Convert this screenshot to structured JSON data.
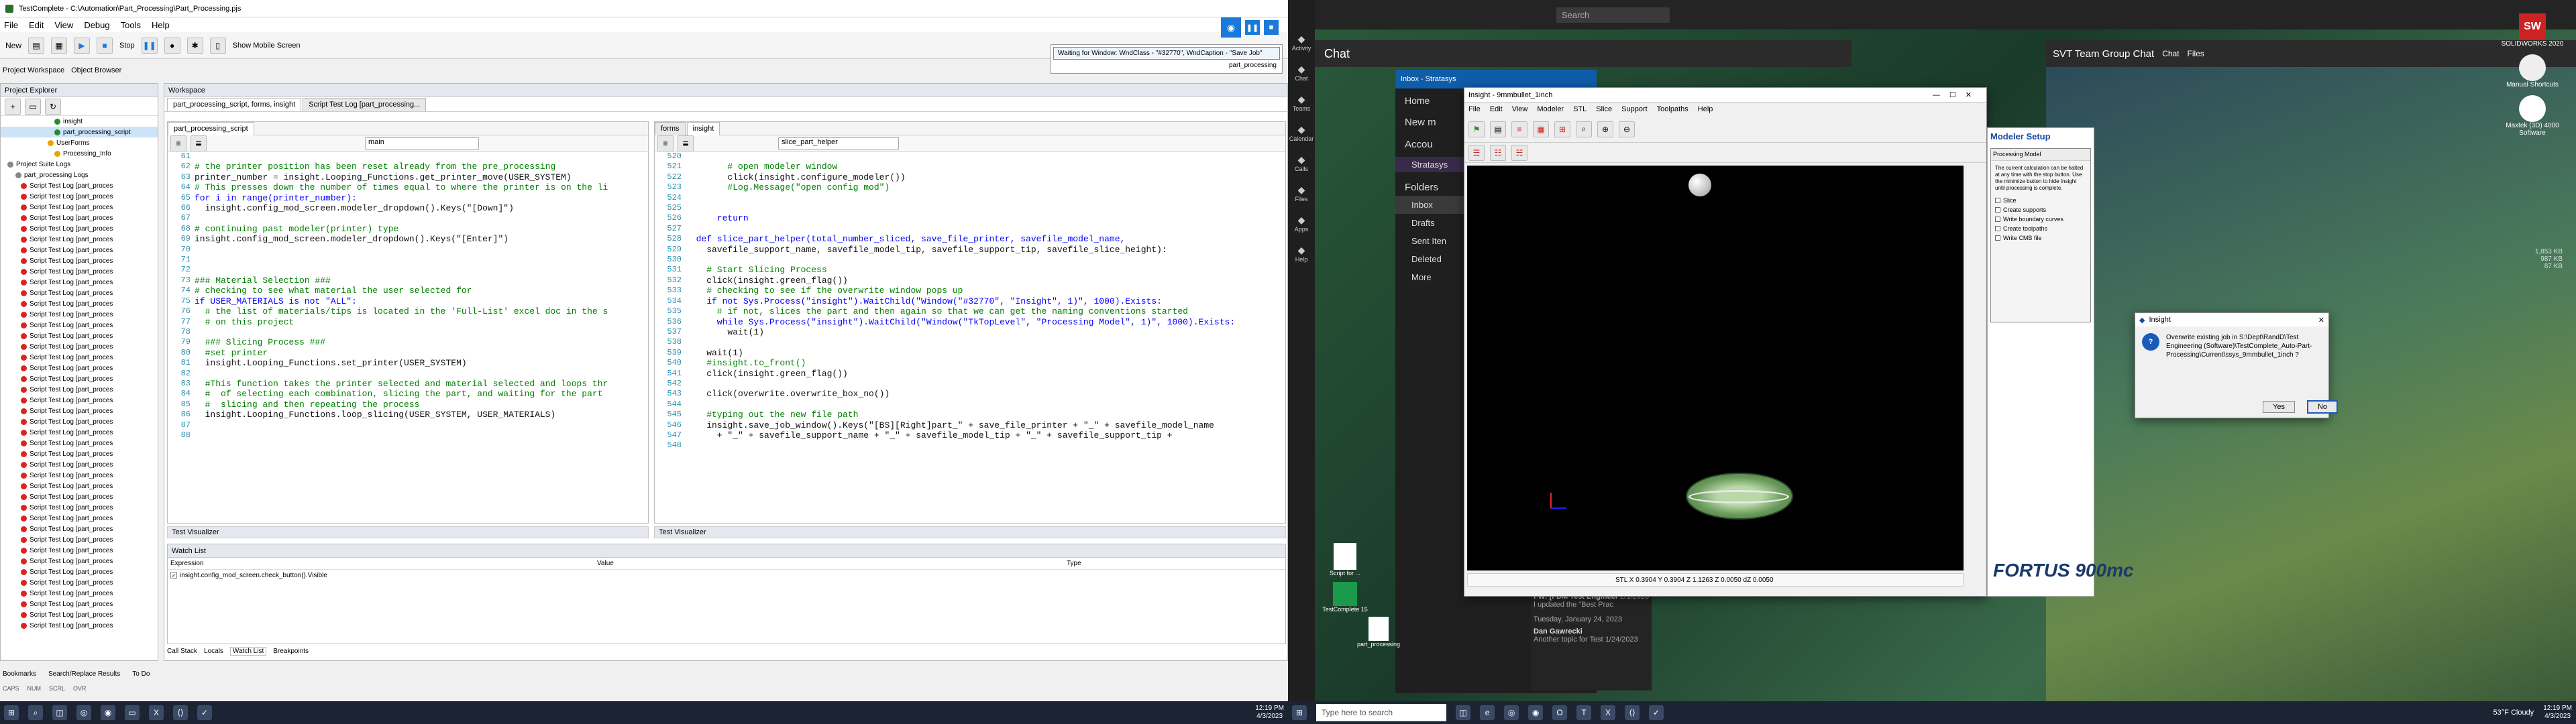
{
  "left": {
    "title": "TestComplete - C:\\Automation\\Part_Processing\\Part_Processing.pjs",
    "menu": [
      "File",
      "Edit",
      "View",
      "Debug",
      "Tools",
      "Help"
    ],
    "toolbar": {
      "new_label": "New",
      "stop_label": "Stop",
      "mobile_label": "Show Mobile Screen"
    },
    "waiting_text": "Waiting for Window: WndClass - \"#32770\", WndCaption - \"Save Job\"",
    "waiting_sub": "part_processing",
    "project_tabs": [
      "Project Workspace",
      "Object Browser"
    ],
    "explorer_title": "Project Explorer",
    "tree_top": [
      "insight",
      "part_processing_script",
      "UserForms",
      "Processing_Info"
    ],
    "suite_logs": "Project Suite Logs",
    "processing_logs": "part_processing Logs",
    "log_item": "Script Test Log [part_proces",
    "workspace_title": "Workspace",
    "ws_tabs": [
      "part_processing_script, forms, insight",
      "Script Test Log [part_processing..."
    ],
    "left_editor_tab": "part_processing_script",
    "left_dropdown": "main",
    "right_editor_tabs": [
      "forms",
      "insight"
    ],
    "right_dropdown": "slice_part_helper",
    "left_code_start": 61,
    "left_code": [
      {
        "t": "",
        "c": ""
      },
      {
        "t": "# the printer position has been reset already from the pre_processing",
        "c": "cm"
      },
      {
        "t": "printer_number = insight.Looping_Functions.get_printer_move(USER_SYSTEM)",
        "c": ""
      },
      {
        "t": "# This presses down the number of times equal to where the printer is on the li",
        "c": "cm"
      },
      {
        "t": "for i in range(printer_number):",
        "c": "kw"
      },
      {
        "t": "  insight.config_mod_screen.modeler_dropdown().Keys(\"[Down]\")",
        "c": ""
      },
      {
        "t": "",
        "c": ""
      },
      {
        "t": "# continuing past modeler(printer) type",
        "c": "cm"
      },
      {
        "t": "insight.config_mod_screen.modeler_dropdown().Keys(\"[Enter]\")",
        "c": ""
      },
      {
        "t": "",
        "c": ""
      },
      {
        "t": "",
        "c": ""
      },
      {
        "t": "",
        "c": ""
      },
      {
        "t": "### Material Selection ###",
        "c": "cm"
      },
      {
        "t": "# checking to see what material the user selected for",
        "c": "cm"
      },
      {
        "t": "if USER_MATERIALS is not \"ALL\":",
        "c": "kw"
      },
      {
        "t": "  # the list of materials/tips is located in the 'Full-List' excel doc in the s",
        "c": "cm"
      },
      {
        "t": "  # on this project",
        "c": "cm"
      },
      {
        "t": "",
        "c": ""
      },
      {
        "t": "  ### Slicing Process ###",
        "c": "cm"
      },
      {
        "t": "  #set printer",
        "c": "cm"
      },
      {
        "t": "  insight.Looping_Functions.set_printer(USER_SYSTEM)",
        "c": ""
      },
      {
        "t": "",
        "c": ""
      },
      {
        "t": "  #This function takes the printer selected and material selected and loops thr",
        "c": "cm"
      },
      {
        "t": "  #  of selecting each combination, slicing the part, and waiting for the part",
        "c": "cm"
      },
      {
        "t": "  #  slicing and then repeating the process",
        "c": "cm"
      },
      {
        "t": "  insight.Looping_Functions.loop_slicing(USER_SYSTEM, USER_MATERIALS)",
        "c": ""
      },
      {
        "t": "",
        "c": ""
      },
      {
        "t": "",
        "c": ""
      }
    ],
    "right_code_start": 520,
    "right_code": [
      {
        "t": "",
        "c": ""
      },
      {
        "t": "        # open modeler window",
        "c": "cm"
      },
      {
        "t": "        click(insight.configure_modeler())",
        "c": ""
      },
      {
        "t": "        #Log.Message(\"open config mod\")",
        "c": "cm"
      },
      {
        "t": "",
        "c": ""
      },
      {
        "t": "",
        "c": ""
      },
      {
        "t": "      return",
        "c": "kw"
      },
      {
        "t": "",
        "c": ""
      },
      {
        "t": "  def slice_part_helper(total_number_sliced, save_file_printer, savefile_model_name,",
        "c": "kw"
      },
      {
        "t": "    savefile_support_name, savefile_model_tip, savefile_support_tip, savefile_slice_height):",
        "c": ""
      },
      {
        "t": "",
        "c": ""
      },
      {
        "t": "    # Start Slicing Process",
        "c": "cm"
      },
      {
        "t": "    click(insight.green_flag())",
        "c": ""
      },
      {
        "t": "    # checking to see if the overwrite window pops up",
        "c": "cm"
      },
      {
        "t": "    if not Sys.Process(\"insight\").WaitChild(\"Window(\"#32770\", \"Insight\", 1)\", 1000).Exists:",
        "c": "kw"
      },
      {
        "t": "      # if not, slices the part and then again so that we can get the naming conventions started",
        "c": "cm"
      },
      {
        "t": "      while Sys.Process(\"insight\").WaitChild(\"Window(\"TkTopLevel\", \"Processing Model\", 1)\", 1000).Exists:",
        "c": "kw"
      },
      {
        "t": "        wait(1)",
        "c": ""
      },
      {
        "t": "",
        "c": ""
      },
      {
        "t": "    wait(1)",
        "c": ""
      },
      {
        "t": "    #insight.to_front()",
        "c": "cm"
      },
      {
        "t": "    click(insight.green_flag())",
        "c": ""
      },
      {
        "t": "",
        "c": ""
      },
      {
        "t": "    click(overwrite.overwrite_box_no())",
        "c": ""
      },
      {
        "t": "",
        "c": ""
      },
      {
        "t": "    #typing out the new file path",
        "c": "cm"
      },
      {
        "t": "    insight.save_job_window().Keys(\"[BS][Right]part_\" + save_file_printer + \"_\" + savefile_model_name",
        "c": ""
      },
      {
        "t": "      + \"_\" + savefile_support_name + \"_\" + savefile_model_tip + \"_\" + savefile_support_tip +",
        "c": ""
      },
      {
        "t": "",
        "c": ""
      }
    ],
    "visualizer_label": "Test Visualizer",
    "watch_title": "Watch List",
    "watch_cols": [
      "Expression",
      "Value",
      "Type"
    ],
    "watch_row": "insight.config_mod_screen.check_button().Visible",
    "bottom_tabs": [
      "Call Stack",
      "Locals",
      "Watch List",
      "Breakpoints"
    ],
    "bottom_tabs2": [
      "Bookmarks",
      "Search/Replace Results",
      "To Do"
    ],
    "status": [
      "CAPS",
      "NUM",
      "SCRL",
      "OVR"
    ],
    "time": "12:19 PM",
    "date": "4/3/2023"
  },
  "right": {
    "chat_title": "Chat",
    "search_placeholder": "Search",
    "team_chat_title": "SVT Team Group Chat",
    "team_tabs": [
      "Chat",
      "Files"
    ],
    "sidebar": [
      "Activity",
      "Chat",
      "Teams",
      "Calendar",
      "Calls",
      "Files",
      "Apps",
      "Help"
    ],
    "outlook_title": "Inbox - Stratasys",
    "home": "Home",
    "new_mail": "New m",
    "account": "Accou",
    "stratasys": "Stratasys",
    "folders": "Folders",
    "folder_items": [
      "Inbox",
      "Drafts",
      "Sent Iten",
      "Deleted",
      "More"
    ],
    "insight_title": "Insight - 9mmbullet_1inch",
    "insight_menu": [
      "File",
      "Edit",
      "View",
      "Modeler",
      "STL",
      "Slice",
      "Support",
      "Toolpaths",
      "Help"
    ],
    "modeler_setup": "Modeler Setup",
    "proc_model_title": "Processing Model",
    "proc_desc": "The current calculation can be halted at any time with the stop button. Use the minimize button to hide Insight until processing is complete.",
    "checks": [
      "Slice",
      "Create supports",
      "Write boundary curves",
      "Create toolpaths",
      "Write CMB file"
    ],
    "dialog_title": "Insight",
    "dialog_msg": "Overwrite existing job in S:\\Dept\\RandD\\Test Engineering (Software)\\TestComplete_Auto-Part-Processing\\Current\\ssys_9mmbullet_1inch ?",
    "yes": "Yes",
    "no": "No",
    "fortus": "FORTUS 900mc",
    "status_bar": "STL  X 0.3904  Y 0.3904  Z 1.1263  Z 0.0050  dZ 0.0050",
    "mail_items": [
      {
        "title": "FW: [FDM Test Engineer",
        "date": "2/1/2023",
        "snippet": "I updated the \"Best Prac"
      },
      {
        "title": "Tuesday, January 24, 2023",
        "date": "",
        "snippet": ""
      },
      {
        "title": "Dan Gawrecki",
        "date": "",
        "snippet": "Another topic for Test"
      }
    ],
    "mail_date2": "1/24/2023",
    "desktop_icons": [
      "SOLIDWORKS 2020",
      "Manual Shortcuts",
      "Maxtek (3D) 4000 Software"
    ],
    "desktop_files": [
      "Script for ...",
      "TestComplete 15",
      "part_processing"
    ],
    "taskbar_search": "Type here to search",
    "weather": "53°F Cloudy",
    "time": "12:19 PM",
    "date": "4/3/2023",
    "size_labels": [
      "1,853 KB",
      "987 KB",
      "87 KB"
    ]
  }
}
